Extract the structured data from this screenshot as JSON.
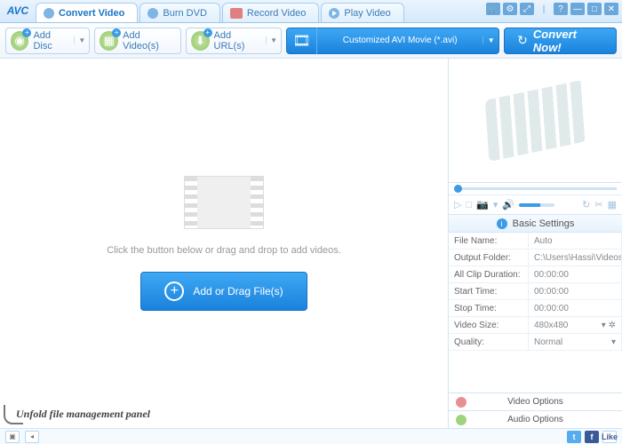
{
  "app": {
    "logo": "AVC"
  },
  "tabs": [
    {
      "label": "Convert Video"
    },
    {
      "label": "Burn DVD"
    },
    {
      "label": "Record Video"
    },
    {
      "label": "Play Video"
    }
  ],
  "toolbar": {
    "add_disc": "Add Disc",
    "add_videos": "Add Video(s)",
    "add_urls": "Add URL(s)",
    "format_label": "Customized AVI Movie (*.avi)",
    "convert": "Convert Now!"
  },
  "dropzone": {
    "hint": "Click the button below or drag and drop to add videos.",
    "button": "Add or Drag File(s)",
    "unfold": "Unfold file management panel"
  },
  "settings": {
    "header": "Basic Settings",
    "rows": {
      "file_name": {
        "label": "File Name:",
        "value": "Auto"
      },
      "output_folder": {
        "label": "Output Folder:",
        "value": "C:\\Users\\Hassi\\Videos\\..."
      },
      "all_clip_duration": {
        "label": "All Clip Duration:",
        "value": "00:00:00"
      },
      "start_time": {
        "label": "Start Time:",
        "value": "00:00:00"
      },
      "stop_time": {
        "label": "Stop Time:",
        "value": "00:00:00"
      },
      "video_size": {
        "label": "Video Size:",
        "value": "480x480"
      },
      "quality": {
        "label": "Quality:",
        "value": "Normal"
      }
    },
    "video_options": "Video Options",
    "audio_options": "Audio Options"
  },
  "statusbar": {
    "like": "Like"
  }
}
